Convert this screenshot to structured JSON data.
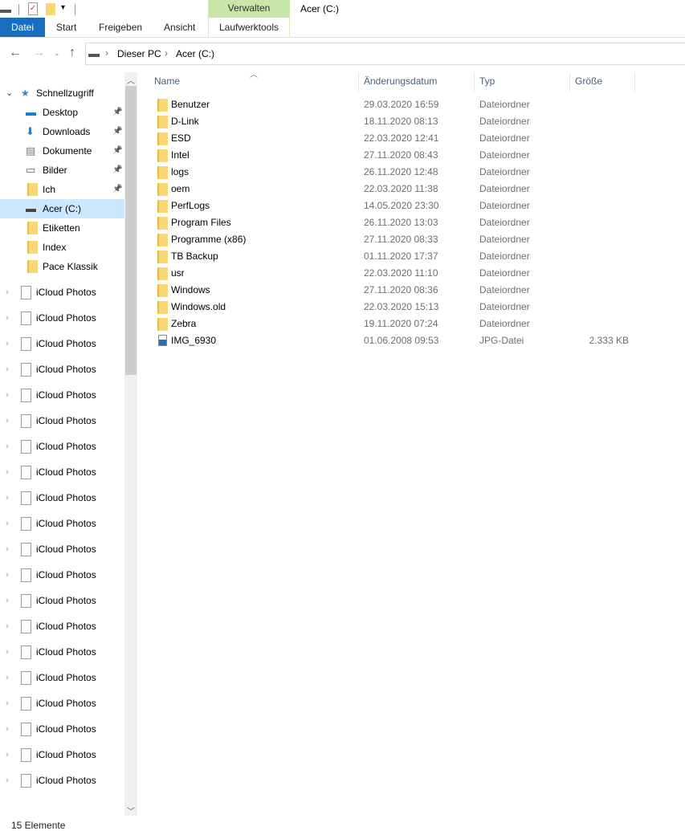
{
  "window": {
    "title": "Acer (C:)"
  },
  "ribbon": {
    "context_group": "Verwalten",
    "tabs": [
      "Datei",
      "Start",
      "Freigeben",
      "Ansicht"
    ],
    "context_tab": "Laufwerktools"
  },
  "address": {
    "crumbs": [
      "Dieser PC",
      "Acer (C:)"
    ]
  },
  "sidebar": {
    "quick_access": "Schnellzugriff",
    "items": [
      {
        "label": "Desktop",
        "icon": "desktop-icon",
        "pinned": true
      },
      {
        "label": "Downloads",
        "icon": "download-icon",
        "pinned": true
      },
      {
        "label": "Dokumente",
        "icon": "documents-icon",
        "pinned": true
      },
      {
        "label": "Bilder",
        "icon": "pictures-icon",
        "pinned": true
      },
      {
        "label": "Ich",
        "icon": "folder-icon",
        "pinned": true
      },
      {
        "label": "Acer (C:)",
        "icon": "drive-icon",
        "pinned": false,
        "selected": true
      },
      {
        "label": "Etiketten",
        "icon": "folder-icon",
        "pinned": false
      },
      {
        "label": "Index",
        "icon": "folder-icon",
        "pinned": false
      },
      {
        "label": "Pace Klassik",
        "icon": "folder-icon",
        "pinned": false
      }
    ],
    "icloud": [
      "iCloud Photos",
      "iCloud Photos",
      "iCloud Photos",
      "iCloud Photos",
      "iCloud Photos",
      "iCloud Photos",
      "iCloud Photos",
      "iCloud Photos",
      "iCloud Photos",
      "iCloud Photos",
      "iCloud Photos",
      "iCloud Photos",
      "iCloud Photos",
      "iCloud Photos",
      "iCloud Photos",
      "iCloud Photos",
      "iCloud Photos",
      "iCloud Photos",
      "iCloud Photos",
      "iCloud Photos"
    ]
  },
  "columns": {
    "name": "Name",
    "date": "Änderungsdatum",
    "type": "Typ",
    "size": "Größe"
  },
  "files": [
    {
      "name": "Benutzer",
      "date": "29.03.2020 16:59",
      "type": "Dateiordner",
      "size": ""
    },
    {
      "name": "D-Link",
      "date": "18.11.2020 08:13",
      "type": "Dateiordner",
      "size": ""
    },
    {
      "name": "ESD",
      "date": "22.03.2020 12:41",
      "type": "Dateiordner",
      "size": ""
    },
    {
      "name": "Intel",
      "date": "27.11.2020 08:43",
      "type": "Dateiordner",
      "size": ""
    },
    {
      "name": "logs",
      "date": "26.11.2020 12:48",
      "type": "Dateiordner",
      "size": ""
    },
    {
      "name": "oem",
      "date": "22.03.2020 11:38",
      "type": "Dateiordner",
      "size": ""
    },
    {
      "name": "PerfLogs",
      "date": "14.05.2020 23:30",
      "type": "Dateiordner",
      "size": ""
    },
    {
      "name": "Program Files",
      "date": "26.11.2020 13:03",
      "type": "Dateiordner",
      "size": ""
    },
    {
      "name": "Programme (x86)",
      "date": "27.11.2020 08:33",
      "type": "Dateiordner",
      "size": ""
    },
    {
      "name": "TB Backup",
      "date": "01.11.2020 17:37",
      "type": "Dateiordner",
      "size": ""
    },
    {
      "name": "usr",
      "date": "22.03.2020 11:10",
      "type": "Dateiordner",
      "size": ""
    },
    {
      "name": "Windows",
      "date": "27.11.2020 08:36",
      "type": "Dateiordner",
      "size": ""
    },
    {
      "name": "Windows.old",
      "date": "22.03.2020 15:13",
      "type": "Dateiordner",
      "size": ""
    },
    {
      "name": "Zebra",
      "date": "19.11.2020 07:24",
      "type": "Dateiordner",
      "size": ""
    },
    {
      "name": "IMG_6930",
      "date": "01.06.2008 09:53",
      "type": "JPG-Datei",
      "size": "2.333 KB"
    }
  ],
  "status": {
    "count": "15 Elemente"
  },
  "colors": {
    "accent": "#1a6ec0",
    "context": "#c8e6a8",
    "selection": "#cce8ff",
    "folder": "#f8d775"
  }
}
